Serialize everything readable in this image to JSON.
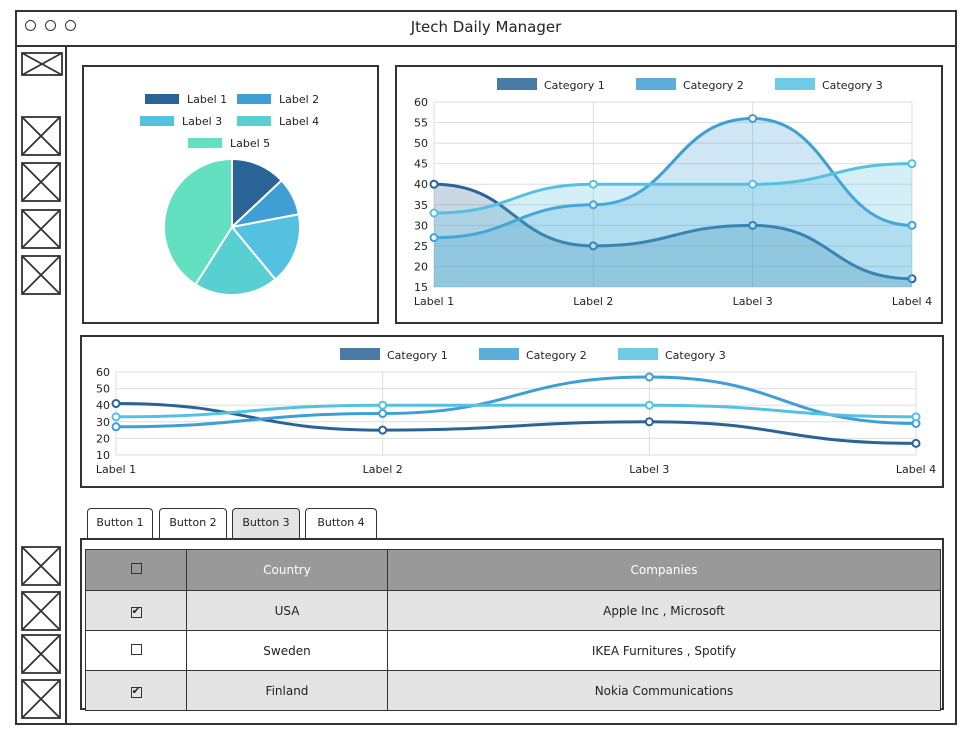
{
  "window": {
    "title": "Jtech Daily Manager"
  },
  "colors": {
    "cat1": "#2a6396",
    "cat2": "#3f9fd4",
    "cat3": "#55c1e1",
    "label4": "#58cfd0",
    "label5": "#62e0bf"
  },
  "pie_chart": {
    "legend": [
      "Label 1",
      "Label 2",
      "Label 3",
      "Label 4",
      "Label 5"
    ]
  },
  "tabs": [
    {
      "label": "Button 1"
    },
    {
      "label": "Button 2"
    },
    {
      "label": "Button 3"
    },
    {
      "label": "Button 4"
    }
  ],
  "table": {
    "headers": {
      "country": "Country",
      "companies": "Companies"
    },
    "rows": [
      {
        "checked": true,
        "country": "USA",
        "companies": "Apple Inc , Microsoft"
      },
      {
        "checked": false,
        "country": "Sweden",
        "companies": "IKEA Furnitures , Spotify"
      },
      {
        "checked": true,
        "country": "Finland",
        "companies": "Nokia Communications"
      }
    ]
  },
  "chart_data": [
    {
      "type": "pie",
      "categories": [
        "Label 1",
        "Label 2",
        "Label 3",
        "Label 4",
        "Label 5"
      ],
      "values": [
        13,
        9,
        17,
        20,
        41
      ]
    },
    {
      "type": "area",
      "categories": [
        "Label 1",
        "Label 2",
        "Label 3",
        "Label 4"
      ],
      "series": [
        {
          "name": "Category 1",
          "values": [
            40,
            25,
            30,
            17
          ]
        },
        {
          "name": "Category 2",
          "values": [
            27,
            35,
            56,
            30
          ]
        },
        {
          "name": "Category 3",
          "values": [
            33,
            40,
            40,
            45
          ]
        }
      ],
      "ylim": [
        15,
        60
      ],
      "yticks": [
        15,
        20,
        25,
        30,
        35,
        40,
        45,
        50,
        55,
        60
      ],
      "grid": true,
      "legend": "top"
    },
    {
      "type": "line",
      "categories": [
        "Label 1",
        "Label 2",
        "Label 3",
        "Label 4"
      ],
      "series": [
        {
          "name": "Category 1",
          "values": [
            41,
            25,
            30,
            17
          ]
        },
        {
          "name": "Category 2",
          "values": [
            27,
            35,
            57,
            29
          ]
        },
        {
          "name": "Category 3",
          "values": [
            33,
            40,
            40,
            33
          ]
        }
      ],
      "ylim": [
        10,
        60
      ],
      "yticks": [
        10,
        20,
        30,
        40,
        50,
        60
      ],
      "grid": true,
      "legend": "top"
    }
  ]
}
